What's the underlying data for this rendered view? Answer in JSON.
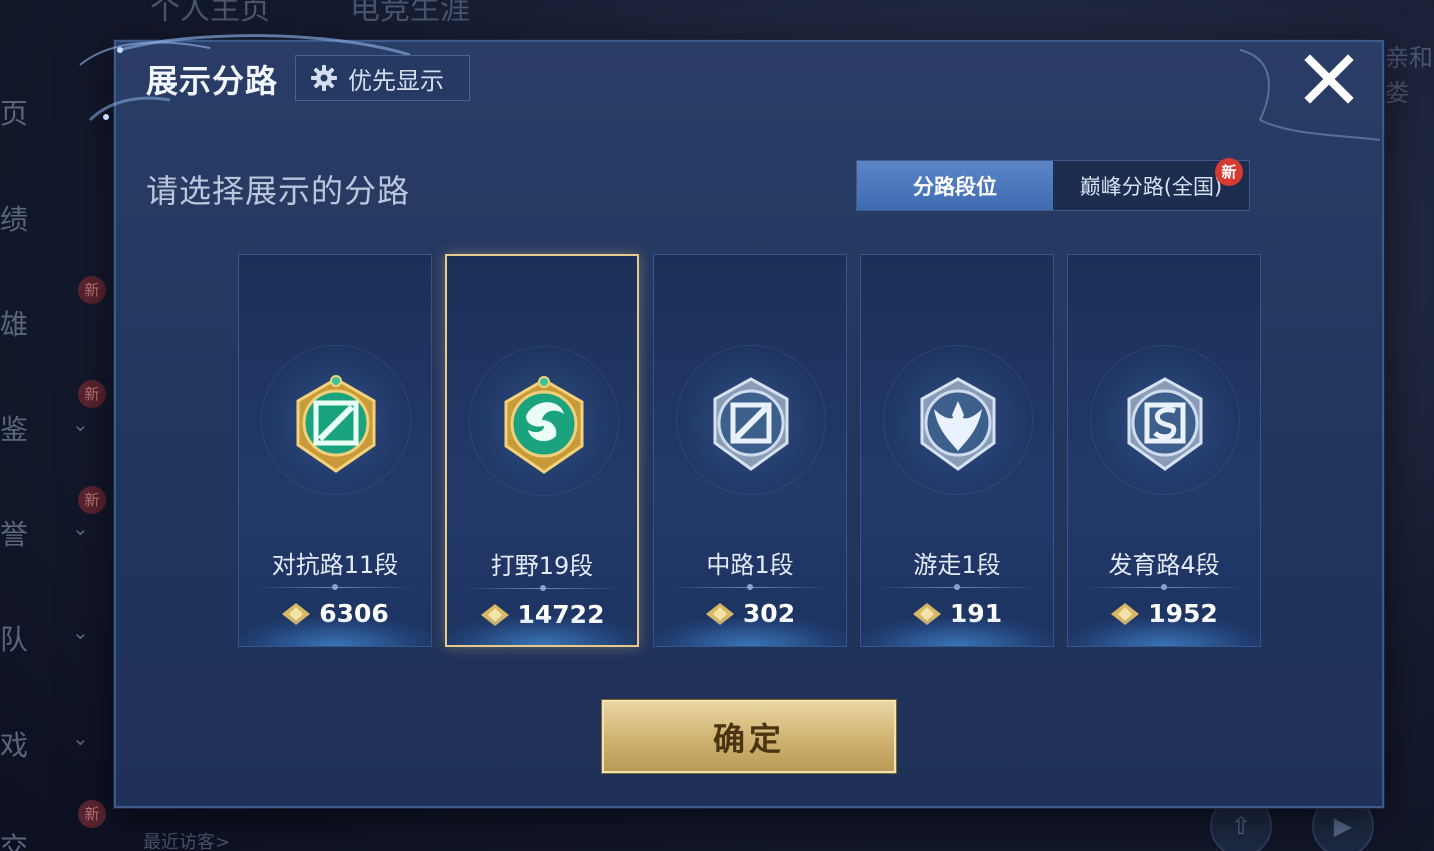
{
  "background": {
    "top_tabs": [
      "个人主页",
      "电竞生涯"
    ],
    "side_items": [
      {
        "label": "页"
      },
      {
        "label": "绩"
      },
      {
        "label": "雄"
      },
      {
        "label": "鉴"
      },
      {
        "label": "誉"
      },
      {
        "label": "队"
      },
      {
        "label": "戏"
      },
      {
        "label": "交"
      }
    ],
    "new_badge": "新",
    "visitors_label": "最近访客>",
    "right_label": "亲和娄"
  },
  "dialog": {
    "title": "展示分路",
    "priority_button": {
      "icon": "gear-icon",
      "label": "优先显示"
    },
    "close_icon": "close-icon",
    "subtitle": "请选择展示的分路",
    "tabs": [
      {
        "label": "分路段位",
        "active": true
      },
      {
        "label": "巅峰分路(全国)",
        "active": false,
        "badge": "新"
      }
    ],
    "cards": [
      {
        "rank": "对抗路11段",
        "score": "6306",
        "icon": "clash-lane-emblem-icon",
        "selected": false,
        "tier": "gold"
      },
      {
        "rank": "打野19段",
        "score": "14722",
        "icon": "jungle-dragon-emblem-icon",
        "selected": true,
        "tier": "gold"
      },
      {
        "rank": "中路1段",
        "score": "302",
        "icon": "mid-lane-emblem-icon",
        "selected": false,
        "tier": "silver"
      },
      {
        "rank": "游走1段",
        "score": "191",
        "icon": "roam-emblem-icon",
        "selected": false,
        "tier": "silver"
      },
      {
        "rank": "发育路4段",
        "score": "1952",
        "icon": "farm-lane-emblem-icon",
        "selected": false,
        "tier": "silver"
      }
    ],
    "confirm_label": "确定"
  },
  "colors": {
    "accent_gold": "#e8c98a",
    "tab_active": "#4a76bd",
    "badge_red": "#d63a33"
  }
}
